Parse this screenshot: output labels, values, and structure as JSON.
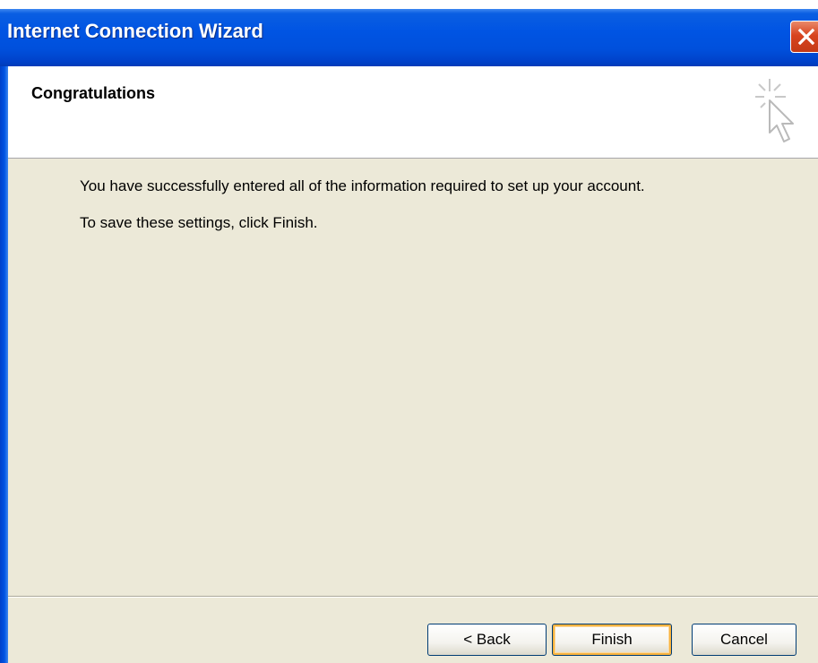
{
  "window": {
    "title": "Internet Connection Wizard"
  },
  "header": {
    "title": "Congratulations"
  },
  "content": {
    "line1": "You have successfully entered all of the information required to set up your account.",
    "line2": "To save these settings, click Finish."
  },
  "buttons": {
    "back": "< Back",
    "finish": "Finish",
    "cancel": "Cancel"
  },
  "icons": {
    "close": "close-icon",
    "wizard": "wizard-sparkle-cursor-icon"
  },
  "colors": {
    "titlebar": "#0054e3",
    "dialog_bg": "#ece9d8",
    "close": "#d8441f",
    "default_button_highlight": "#f8b33f"
  }
}
